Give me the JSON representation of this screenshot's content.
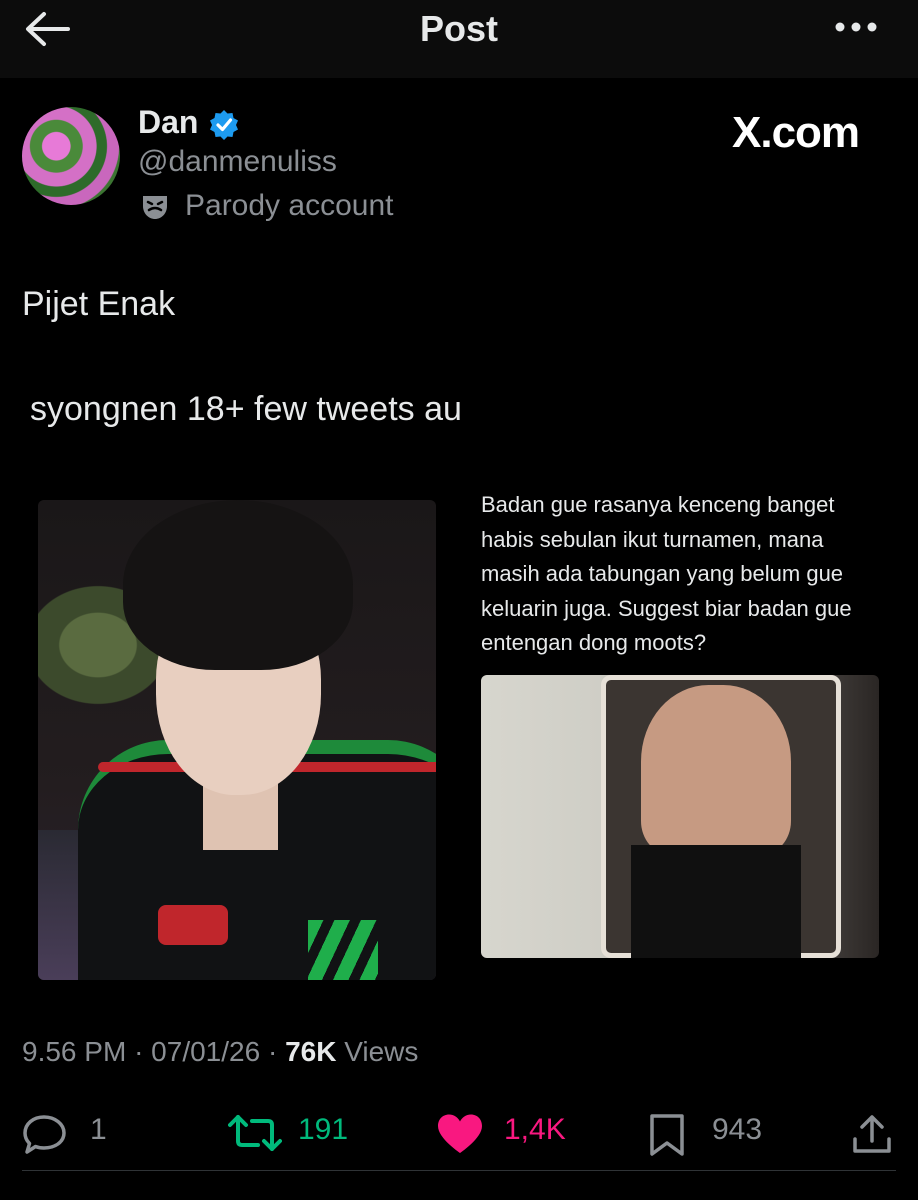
{
  "header": {
    "title": "Post"
  },
  "author": {
    "name": "Dan",
    "handle": "@danmenuliss",
    "label": "Parody account"
  },
  "watermark": "X.com",
  "post": {
    "line1": "Pijet Enak",
    "line2": "syongnen 18+ few tweets au",
    "caption": "Badan gue rasanya kenceng banget habis sebulan ikut turnamen, mana masih ada tabungan yang belum gue keluarin juga. Suggest biar badan gue entengan dong moots?"
  },
  "meta": {
    "time": "9.56 PM",
    "date": "07/01/26",
    "views_count": "76K",
    "views_label": "Views"
  },
  "actions": {
    "replies": "1",
    "reposts": "191",
    "likes": "1,4K",
    "bookmarks": "943"
  },
  "colors": {
    "repost": "#00ba7c",
    "like": "#f91880",
    "verified": "#1d9bf0",
    "muted": "#8b8f94"
  }
}
